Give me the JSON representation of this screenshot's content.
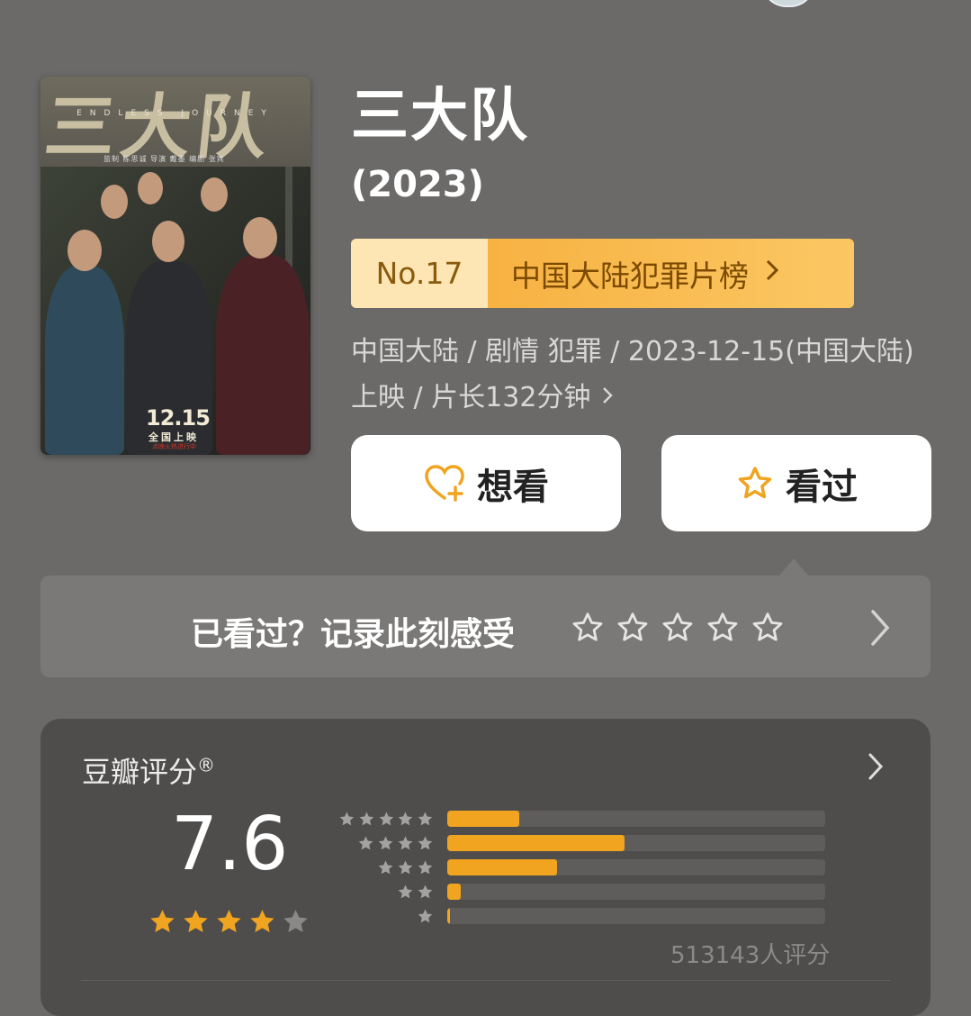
{
  "movie": {
    "title": "三大队",
    "year": "(2023)",
    "poster": {
      "title": "三大队",
      "subtitle_en": "ENDLESS JOURNEY",
      "credits": "监制 陈思诚   导演 戴墨   编剧 张宾",
      "release_date": "12.15",
      "release_label": "全国上映",
      "presale": "点映火热进行中"
    },
    "ranking": {
      "number": "No.17",
      "list_name": "中国大陆犯罪片榜"
    },
    "meta": "中国大陆 / 剧情 犯罪 / 2023-12-15(中国大陆)上映 / 片长132分钟"
  },
  "actions": {
    "want": "想看",
    "seen": "看过"
  },
  "prompt": {
    "text": "已看过？记录此刻感受",
    "star_count": 5
  },
  "rating": {
    "label": "豆瓣评分",
    "registered_mark": "®",
    "score": "7.6",
    "stars_filled": 4,
    "stars_total": 5,
    "distribution": [
      {
        "stars": 5,
        "fraction": 0.19
      },
      {
        "stars": 4,
        "fraction": 0.47
      },
      {
        "stars": 3,
        "fraction": 0.29
      },
      {
        "stars": 2,
        "fraction": 0.035
      },
      {
        "stars": 1,
        "fraction": 0.006
      }
    ],
    "count": "513143人评分"
  },
  "colors": {
    "background": "#6b6a68",
    "star_active": "#f0a41f",
    "ranking_bg": "#f7b84a",
    "ranking_text": "#7c4a00"
  }
}
